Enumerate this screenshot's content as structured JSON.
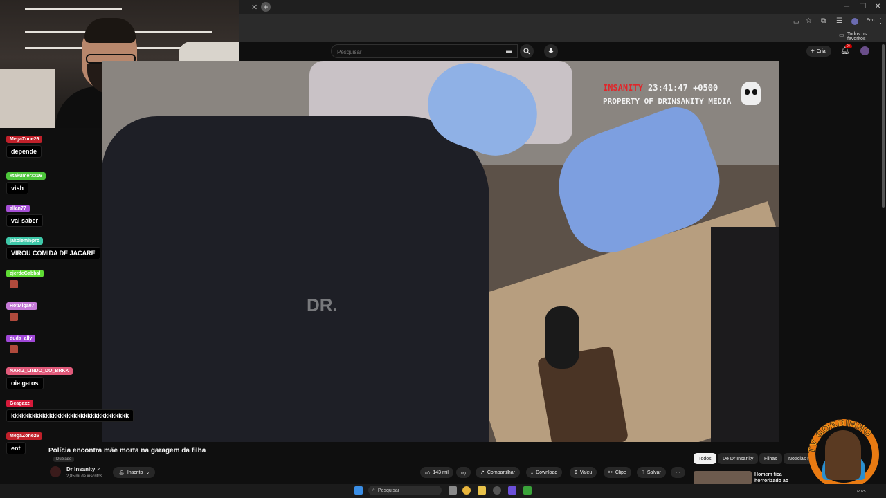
{
  "browser": {
    "tab_close": "✕",
    "new_tab": "+",
    "profile_label": "Erro",
    "bookmarks_label": "Todos os favoritos",
    "window_controls": [
      "─",
      "❐",
      "✕"
    ]
  },
  "youtube": {
    "search_placeholder": "Pesquisar",
    "create_label": "Criar",
    "notification_count": "9+"
  },
  "video": {
    "overlay_brand_red": "INSANITY",
    "overlay_time": "23:41:47",
    "overlay_offset": "+0500",
    "overlay_owner": "PROPERTY OF DRINSANITY MEDIA",
    "watermark": "DR."
  },
  "chat": {
    "messages": [
      {
        "user": "MegaZone26",
        "user_color": "#c0202a",
        "text": "depende"
      },
      {
        "user": "xtakumerxx16",
        "user_color": "#4cc63a",
        "text": "vish"
      },
      {
        "user": "allan77",
        "user_color": "#a64fd6",
        "text": "vai saber"
      },
      {
        "user": "jakolemi5pro",
        "user_color": "#3ec7a8",
        "text": "VIROU COMIDA DE JACARE"
      },
      {
        "user": "ejerdeGabbal",
        "user_color": "#5fdc34",
        "text": ""
      },
      {
        "user": "HotMiga07",
        "user_color": "#c67ad8",
        "text": ""
      },
      {
        "user": "duda_ally",
        "user_color": "#a148d8",
        "text": ""
      },
      {
        "user": "NARIZ_LINDO_DO_BRKK",
        "user_color": "#e05a7a",
        "text": "oie gatos"
      },
      {
        "user": "Geagaxz",
        "user_color": "#d61a3a",
        "text": "kkkkkkkkkkkkkkkkkkkkkkkkkkkkkkkkkk"
      },
      {
        "user": "MegaZone26",
        "user_color": "#c0202a",
        "text": "ent"
      }
    ]
  },
  "watch": {
    "title": "Polícia encontra mãe morta na garagem da filha",
    "dubbed_badge": "Dublado",
    "channel_name": "Dr Insanity",
    "verified": "✓",
    "subscribers": "2,85 mi de inscritos",
    "subscribed_label": "Inscrito",
    "likes": "143 mil",
    "share_label": "Compartilhar",
    "download_label": "Download",
    "thanks_label": "Valeu",
    "clip_label": "Clipe",
    "save_label": "Salvar",
    "more_label": "···"
  },
  "chips": [
    "Todos",
    "De Dr Insanity",
    "Filhas",
    "Notícias m"
  ],
  "recommendation": {
    "title": "Homem fica horrorizado ao descobrir o terrível segredo"
  },
  "taskbar": {
    "search_label": "Pesquisar",
    "year": "/2025"
  },
  "logo": {
    "text": "TV GORDINHO"
  }
}
